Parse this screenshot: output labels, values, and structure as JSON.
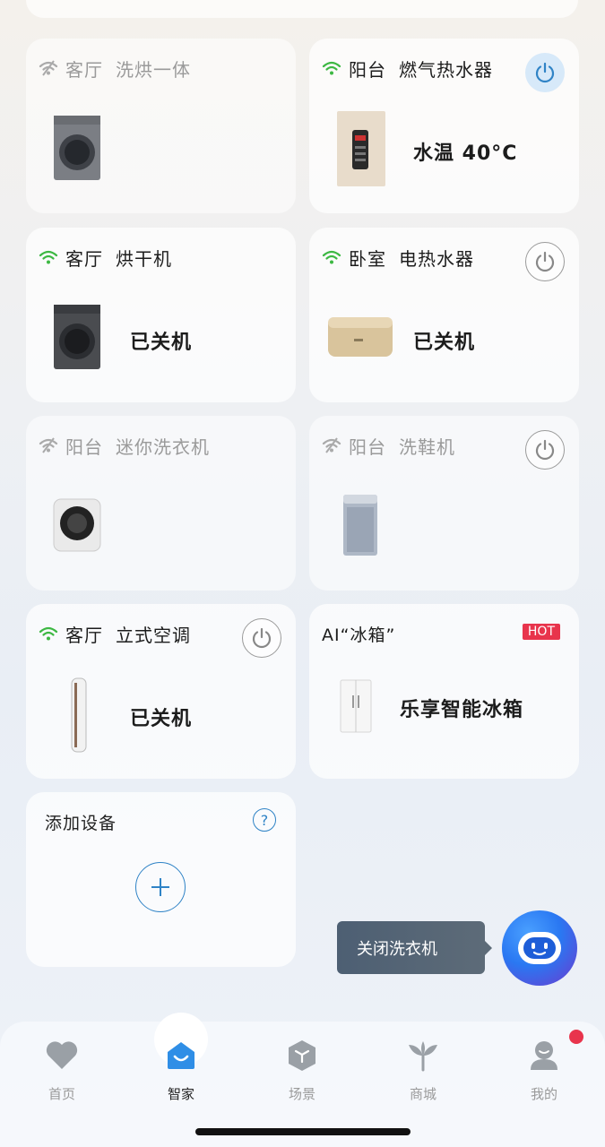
{
  "cards": [
    {
      "room": "客厅",
      "name": "洗烘一体",
      "online": false
    },
    {
      "room": "阳台",
      "name": "燃气热水器",
      "online": true,
      "state": "水温 40°C"
    },
    {
      "room": "客厅",
      "name": "烘干机",
      "online": true,
      "state": "已关机"
    },
    {
      "room": "卧室",
      "name": "电热水器",
      "online": true,
      "state": "已关机"
    },
    {
      "room": "阳台",
      "name": "迷你洗衣机",
      "online": false
    },
    {
      "room": "阳台",
      "name": "洗鞋机",
      "online": false
    },
    {
      "room": "客厅",
      "name": "立式空调",
      "online": true,
      "state": "已关机"
    }
  ],
  "promo": {
    "title": "AI“冰箱”",
    "badge": "HOT",
    "text": "乐享智能冰箱"
  },
  "add_device": {
    "title": "添加设备",
    "help": "?"
  },
  "tooltip": "关闭洗衣机",
  "tabs": [
    {
      "label": "首页",
      "icon": "heart-icon"
    },
    {
      "label": "智家",
      "icon": "smart-home-icon",
      "active": true
    },
    {
      "label": "场景",
      "icon": "cube-icon"
    },
    {
      "label": "商城",
      "icon": "sprout-icon"
    },
    {
      "label": "我的",
      "icon": "user-icon"
    }
  ],
  "colors": {
    "online": "#3db843",
    "accent": "#2f83c6",
    "hot": "#e8344c"
  }
}
